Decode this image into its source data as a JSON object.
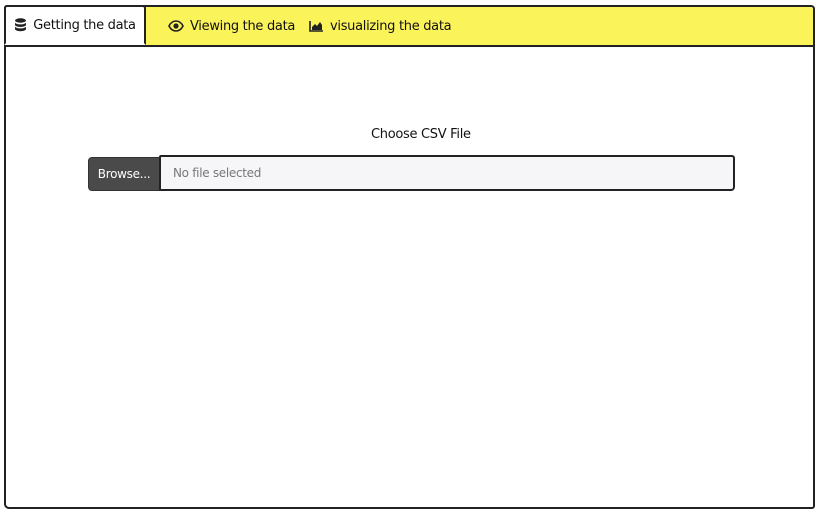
{
  "tabs": [
    {
      "label": "Getting the data",
      "icon": "database-icon",
      "active": true
    },
    {
      "label": "Viewing the data",
      "icon": "eye-icon",
      "active": false
    },
    {
      "label": "visualizing the data",
      "icon": "area-chart-icon",
      "active": false
    }
  ],
  "upload": {
    "label": "Choose CSV File",
    "button_label": "Browse...",
    "placeholder": "No file selected"
  },
  "colors": {
    "tabbar_bg": "#fbf35a",
    "button_bg": "#4a4a4a",
    "input_bg": "#f6f6f8"
  }
}
